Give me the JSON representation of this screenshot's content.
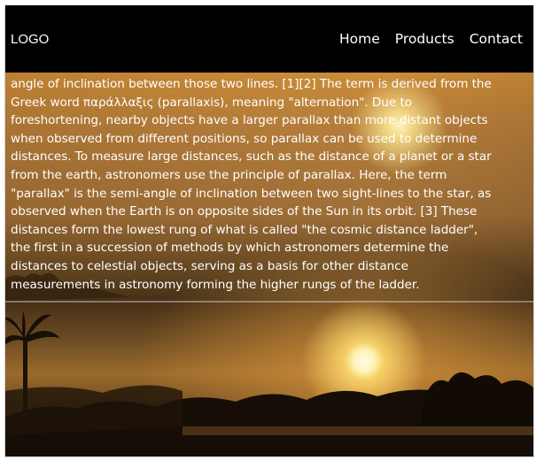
{
  "navbar": {
    "logo": "LOGO",
    "links": [
      "Home",
      "Products",
      "Contact"
    ]
  },
  "article": {
    "lines": [
      "angle of inclination between those two lines. [1][2] The term is derived from the",
      "Greek word παράλλαξις (parallaxis), meaning \"alternation\". Due to",
      "foreshortening, nearby objects have a larger parallax than more distant objects",
      "when observed from different positions, so parallax can be used to determine",
      "distances. To measure large distances, such as the distance of a planet or a star",
      "from the earth, astronomers use the principle of parallax. Here, the term",
      "\"parallax\" is the semi-angle of inclination between two sight-lines to the star, as",
      "observed when the Earth is on opposite sides of the Sun in its orbit. [3] These",
      "distances form the lowest rung of what is called \"the cosmic distance ladder\",",
      "the first in a succession of methods by which astronomers determine the",
      "distances to celestial objects, serving as a basis for other distance",
      "measurements in astronomy forming the higher rungs of the ladder."
    ]
  },
  "background": {
    "scene": "sunset-photo"
  }
}
